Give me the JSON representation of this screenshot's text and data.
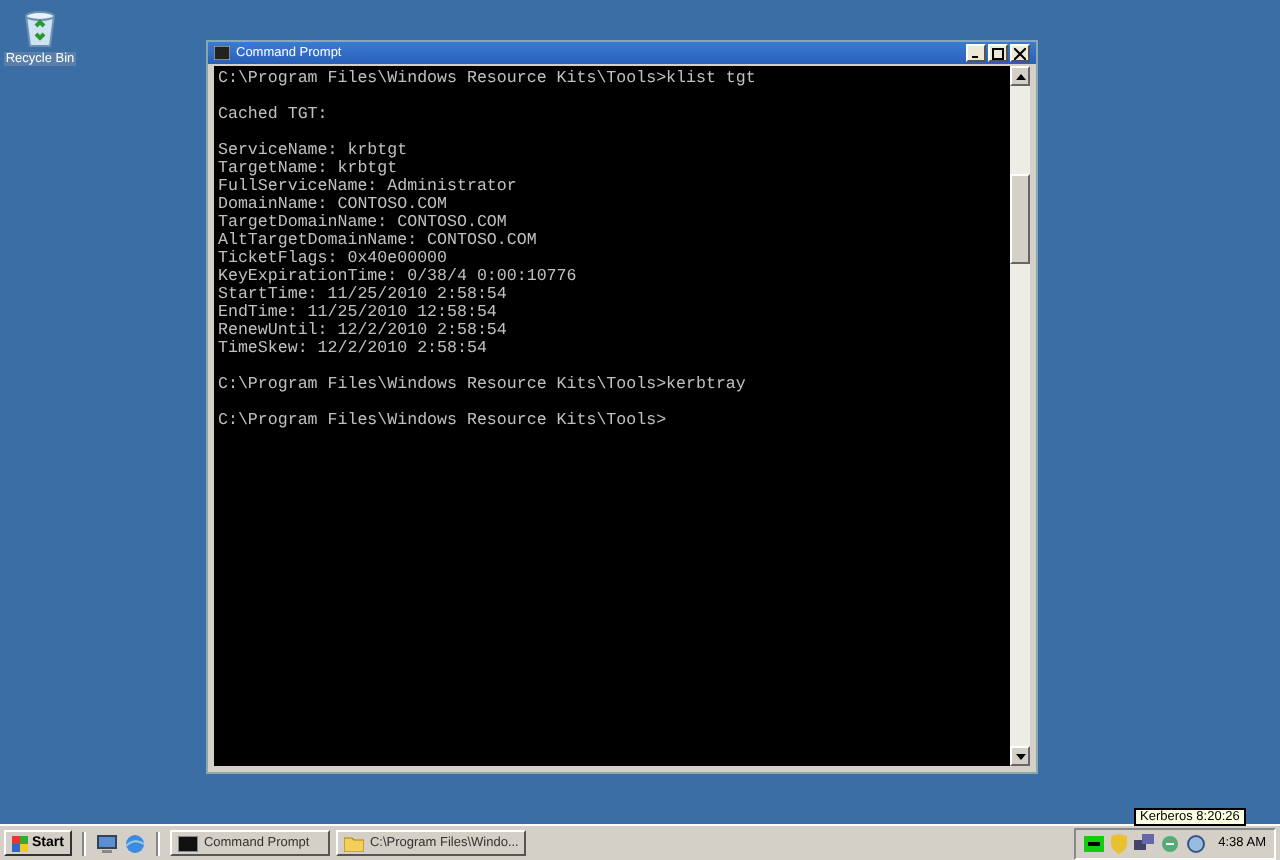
{
  "desktop_icons": [
    {
      "label": "Recycle Bin"
    }
  ],
  "window": {
    "title": "Command Prompt",
    "blocks": [
      [
        "C:\\Program Files\\Windows Resource Kits\\Tools>klist tgt"
      ],
      [
        "Cached TGT:"
      ],
      [
        "ServiceName: krbtgt",
        "TargetName: krbtgt",
        "FullServiceName: Administrator",
        "DomainName: CONTOSO.COM",
        "TargetDomainName: CONTOSO.COM",
        "AltTargetDomainName: CONTOSO.COM",
        "TicketFlags: 0x40e00000",
        "KeyExpirationTime: 0/38/4 0:00:10776",
        "StartTime: 11/25/2010 2:58:54",
        "EndTime: 11/25/2010 12:58:54",
        "RenewUntil: 12/2/2010 2:58:54",
        "TimeSkew: 12/2/2010 2:58:54"
      ],
      [
        "C:\\Program Files\\Windows Resource Kits\\Tools>kerbtray"
      ],
      [
        "C:\\Program Files\\Windows Resource Kits\\Tools>"
      ]
    ]
  },
  "taskbar": {
    "start": "Start",
    "tasks": [
      {
        "label": "Command Prompt",
        "kind": "console",
        "selected": false
      },
      {
        "label": "C:\\Program Files\\Windo...",
        "kind": "folder",
        "selected": false
      }
    ],
    "tooltip": "Kerberos 8:20:26",
    "clock": "4:38 AM"
  }
}
